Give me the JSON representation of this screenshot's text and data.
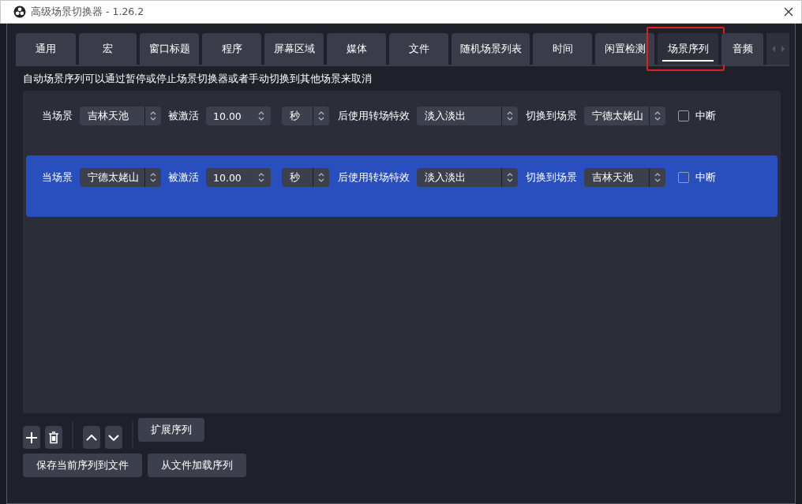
{
  "window": {
    "title": "高级场景切换器 - 1.26.2"
  },
  "tabs": [
    {
      "label": "通用",
      "selected": false,
      "annotated": false
    },
    {
      "label": "宏",
      "selected": false,
      "annotated": false
    },
    {
      "label": "窗口标题",
      "selected": false,
      "annotated": false
    },
    {
      "label": "程序",
      "selected": false,
      "annotated": false
    },
    {
      "label": "屏幕区域",
      "selected": false,
      "annotated": false
    },
    {
      "label": "媒体",
      "selected": false,
      "annotated": false
    },
    {
      "label": "文件",
      "selected": false,
      "annotated": false
    },
    {
      "label": "随机场景列表",
      "selected": false,
      "annotated": false
    },
    {
      "label": "时间",
      "selected": false,
      "annotated": false
    },
    {
      "label": "闲置检测",
      "selected": false,
      "annotated": false
    },
    {
      "label": "场景序列",
      "selected": true,
      "annotated": true
    },
    {
      "label": "音频",
      "selected": false,
      "annotated": false
    }
  ],
  "description": "自动场景序列可以通过暂停或停止场景切换器或者手动切换到其他场景来取消",
  "sequence": [
    {
      "selected": false,
      "current_label": "当场景",
      "scene": "吉林天池",
      "activated_label": "被激活",
      "duration": "10.00",
      "unit": "秒",
      "transition_label": "后使用转场特效",
      "transition": "淡入淡出",
      "switch_label": "切换到场景",
      "target": "宁德太姥山",
      "interrupt_label": "中断",
      "interrupt": false
    },
    {
      "selected": true,
      "current_label": "当场景",
      "scene": "宁德太姥山",
      "activated_label": "被激活",
      "duration": "10.00",
      "unit": "秒",
      "transition_label": "后使用转场特效",
      "transition": "淡入淡出",
      "switch_label": "切换到场景",
      "target": "吉林天池",
      "interrupt_label": "中断",
      "interrupt": false
    }
  ],
  "extend_button": "扩展序列",
  "file_buttons": [
    "保存当前序列到文件",
    "从文件加载序列"
  ]
}
